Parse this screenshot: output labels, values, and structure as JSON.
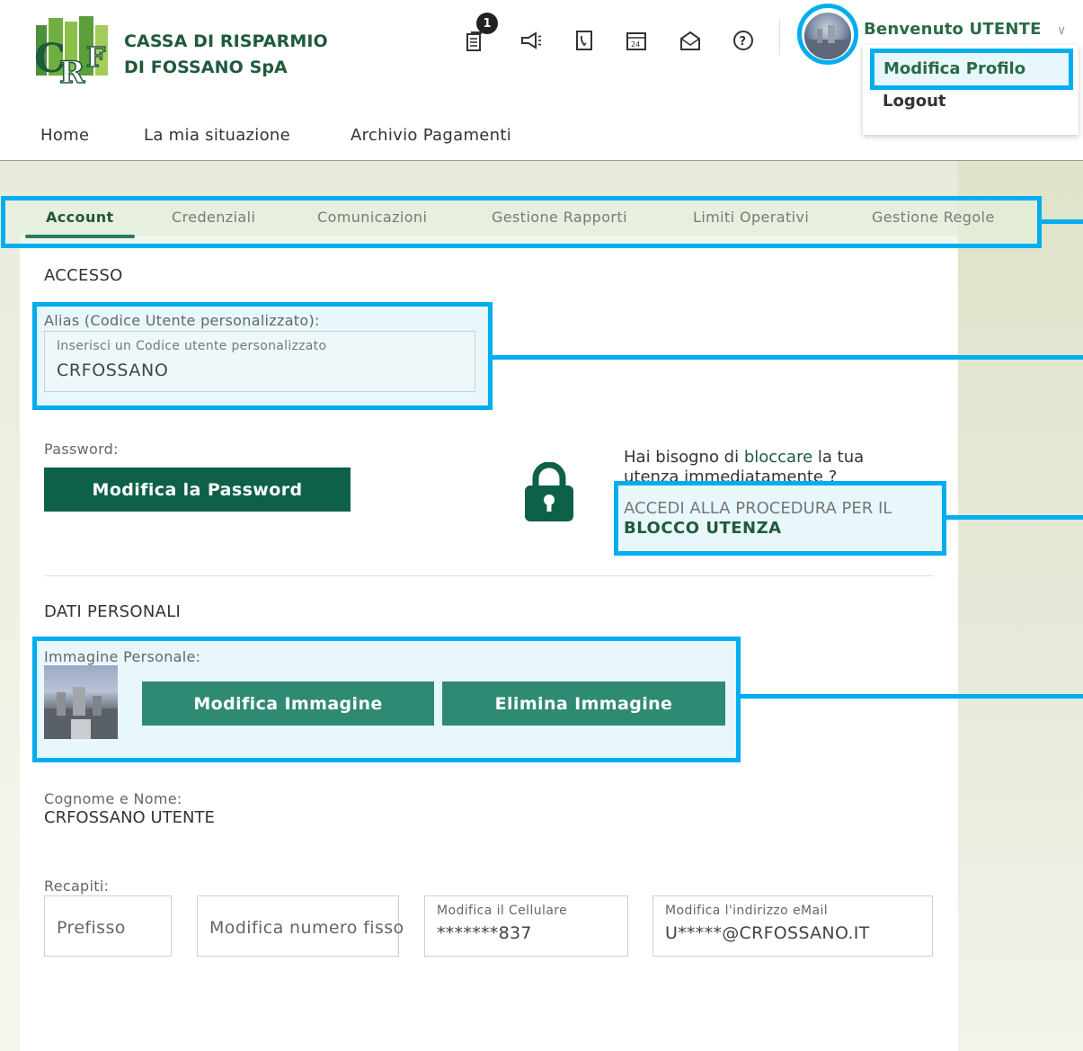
{
  "header": {
    "bank_name_line1": "CASSA DI RISPARMIO",
    "bank_name_line2": "DI FOSSANO SpA",
    "notification_count": "1",
    "welcome": "Benvenuto UTENTE",
    "icons": [
      "documents-icon",
      "megaphone-icon",
      "phonebook-icon",
      "calendar-icon",
      "mail-icon",
      "help-icon"
    ]
  },
  "user_menu": {
    "items": [
      "Modifica Profilo",
      "Logout"
    ]
  },
  "main_nav": {
    "items": [
      "Home",
      "La mia situazione",
      "Archivio Pagamenti"
    ]
  },
  "sub_tabs": {
    "items": [
      "Account",
      "Credenziali",
      "Comunicazioni",
      "Gestione Rapporti",
      "Limiti Operativi",
      "Gestione Regole"
    ],
    "active": "Account"
  },
  "access": {
    "title": "ACCESSO",
    "alias_label": "Alias (Codice Utente personalizzato):",
    "alias_placeholder": "Inserisci un Codice utente personalizzato",
    "alias_value": "CRFOSSANO",
    "password_label": "Password:",
    "password_button": "Modifica la Password",
    "block_question_1": "Hai bisogno di ",
    "block_question_strong": "bloccare",
    "block_question_2": " la tua utenza immediatamente ?",
    "block_link_1": "ACCEDI ALLA PROCEDURA PER IL",
    "block_link_2": "BLOCCO UTENZA"
  },
  "personal": {
    "title": "DATI PERSONALI",
    "image_label": "Immagine Personale:",
    "edit_image_button": "Modifica Immagine",
    "delete_image_button": "Elimina Immagine",
    "name_label": "Cognome e Nome:",
    "name_value": "CRFOSSANO UTENTE",
    "contacts_label": "Recapiti:",
    "prefix_placeholder": "Prefisso",
    "landline_placeholder": "Modifica numero fisso",
    "mobile_label": "Modifica il Cellulare",
    "mobile_value": "*******837",
    "email_label": "Modifica l'indirizzo eMail",
    "email_value": "U*****@CRFOSSANO.IT"
  },
  "colors": {
    "brand_green": "#1f5a3c",
    "button_dark": "#0e6149",
    "button_mid": "#2f8a73",
    "highlight": "#00aeef"
  }
}
